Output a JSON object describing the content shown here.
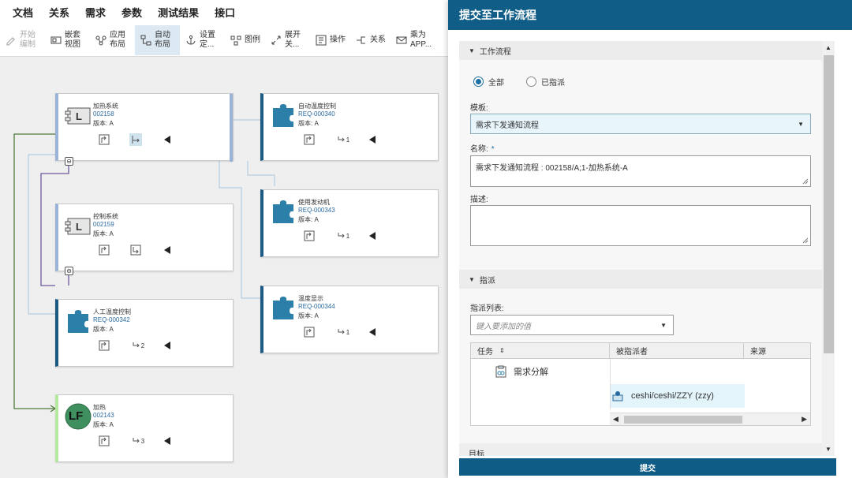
{
  "menubar": {
    "items": [
      "文档",
      "关系",
      "需求",
      "参数",
      "测试结果",
      "接口"
    ]
  },
  "toolbar": {
    "start_edit": [
      "开始",
      "编制"
    ],
    "embed_view": [
      "嵌套",
      "视图"
    ],
    "app_layout": [
      "应用",
      "布局"
    ],
    "auto_layout": [
      "自动",
      "布局"
    ],
    "settings": [
      "设置",
      "定..."
    ],
    "legend": "图例",
    "expand": [
      "展开",
      "关..."
    ],
    "operations": "操作",
    "relations": "关系",
    "send_app": [
      "乘为",
      "APP..."
    ]
  },
  "nodes": {
    "heating_system": {
      "title": "加热系统",
      "id": "002158",
      "version": "版本: A"
    },
    "control_system": {
      "title": "控制系统",
      "id": "002159",
      "version": "版本: A"
    },
    "manual_temp": {
      "title": "人工温度控制",
      "id": "REQ-000342",
      "version": "版本: A",
      "count": "2"
    },
    "heating": {
      "title": "加热",
      "id": "002143",
      "version": "版本: A",
      "count": "3",
      "badge": "LF"
    },
    "auto_temp": {
      "title": "自动温度控制",
      "id": "REQ-000340",
      "version": "版本: A",
      "count": "1"
    },
    "use_engine": {
      "title": "使用发动机",
      "id": "REQ-000343",
      "version": "版本: A",
      "count": "1"
    },
    "temp_display": {
      "title": "温度显示",
      "id": "REQ-000344",
      "version": "版本: A",
      "count": "1"
    },
    "l_glyph": "L"
  },
  "panel": {
    "title": "提交至工作流程",
    "section_workflow": "工作流程",
    "radio_all": "全部",
    "radio_assigned": "已指派",
    "template_label": "模板:",
    "template_value": "需求下发通知流程",
    "name_label": "名称:",
    "name_required": "*",
    "name_value": "需求下发通知流程 : 002158/A;1-加热系统-A",
    "desc_label": "描述:",
    "section_assign": "指派",
    "assign_list_label": "指派列表:",
    "assign_placeholder": "键入要添加的值",
    "col_task": "任务",
    "col_assignee": "被指派者",
    "col_source": "来源",
    "task_name": "需求分解",
    "assignee": "ceshi/ceshi/ZZY (zzy)",
    "section_target": "目标",
    "submit_label": "提交"
  },
  "colors": {
    "header": "#105e87",
    "accent": "#1c6ea4",
    "node_border": "#1c5a84"
  }
}
